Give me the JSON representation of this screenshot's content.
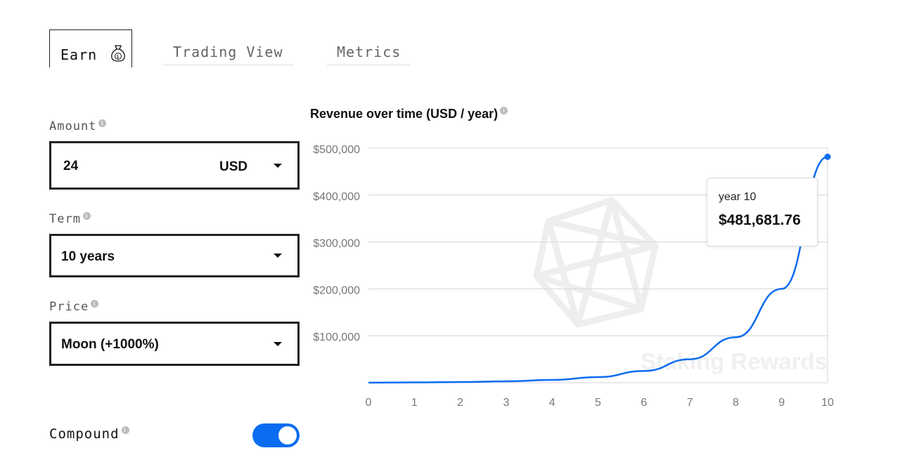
{
  "tabs": [
    {
      "label": "Earn",
      "icon": "money-bag-icon",
      "active": true
    },
    {
      "label": "Trading View"
    },
    {
      "label": "Metrics"
    }
  ],
  "form": {
    "amount": {
      "label": "Amount",
      "value": "24",
      "currency": "USD"
    },
    "term": {
      "label": "Term",
      "value": "10 years"
    },
    "price": {
      "label": "Price",
      "value": "Moon (+1000%)"
    },
    "compound": {
      "label": "Compound",
      "on": true
    }
  },
  "chart_data": {
    "type": "line",
    "title": "Revenue over time (USD / year)",
    "x": [
      0,
      1,
      2,
      3,
      4,
      5,
      6,
      7,
      8,
      9,
      10
    ],
    "values": [
      100,
      700,
      1500,
      3000,
      6000,
      12000,
      25000,
      50000,
      97000,
      200000,
      481681.76
    ],
    "xlim": [
      0,
      10
    ],
    "ylim": [
      0,
      500000
    ],
    "yticks": [
      100000,
      200000,
      300000,
      400000,
      500000
    ],
    "ytick_labels": [
      "$100,000",
      "$200,000",
      "$300,000",
      "$400,000",
      "$500,000"
    ],
    "xtick_labels": [
      "0",
      "1",
      "2",
      "3",
      "4",
      "5",
      "6",
      "7",
      "8",
      "9",
      "10"
    ],
    "grid": true,
    "color": "#0a6cf0",
    "tooltip": {
      "label": "year 10",
      "value": "$481,681.76"
    },
    "watermark": "Staking Rewards"
  }
}
